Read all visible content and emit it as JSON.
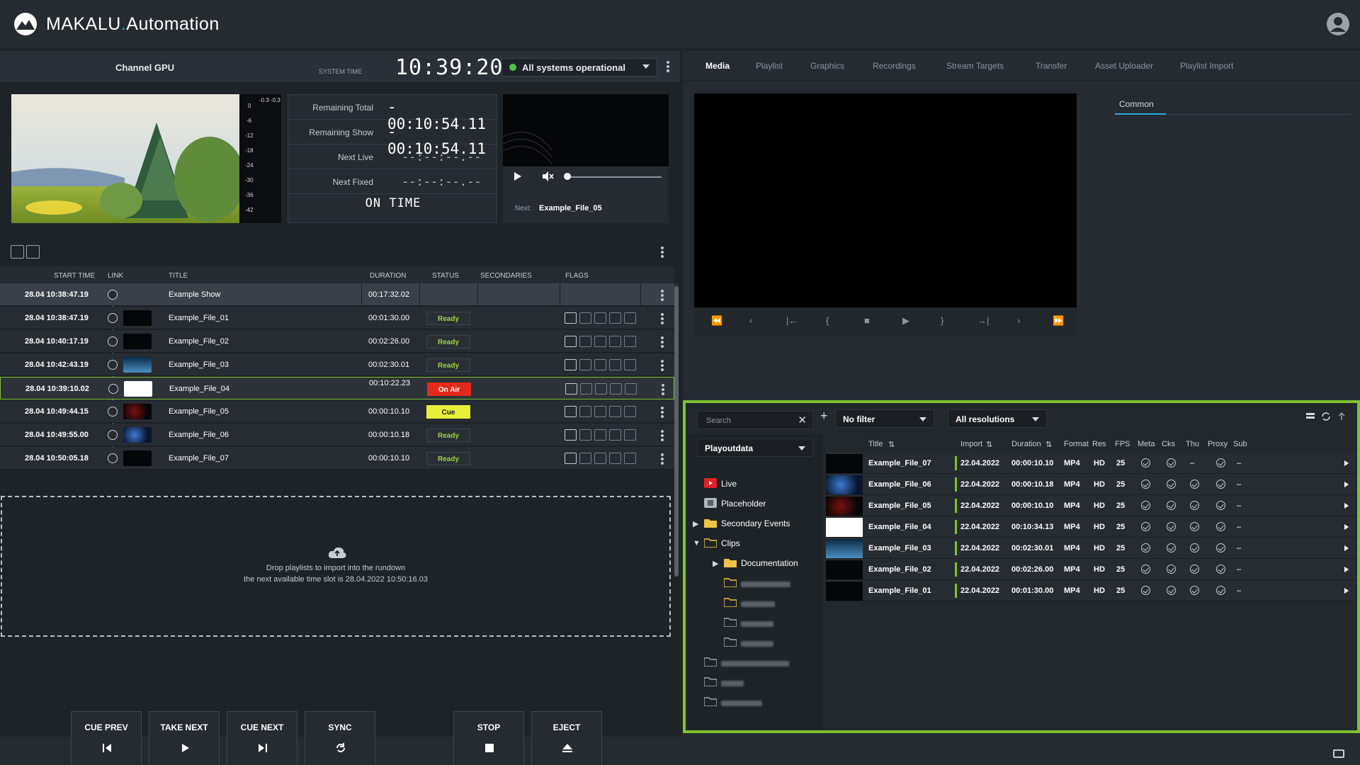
{
  "app": {
    "brand_main": "MAKALU",
    "brand_dot": ".",
    "brand_sub": "Automation"
  },
  "header": {
    "channel": "Channel GPU",
    "system_time_label": "SYSTEM TIME",
    "system_time": "10:39:20",
    "status": "All systems operational",
    "status_color": "#4fc34a"
  },
  "meter": {
    "scale": [
      "0",
      "-6",
      "-12",
      "-18",
      "-24",
      "-30",
      "-36",
      "-42"
    ],
    "peak_l": "-0.3",
    "peak_r": "-0.3"
  },
  "timers": [
    {
      "label": "Remaining Total",
      "value": "- 00:10:54.11"
    },
    {
      "label": "Remaining Show",
      "value": "- 00:10:54.11"
    },
    {
      "label": "Next Live",
      "value": "--:--:--.--"
    },
    {
      "label": "Next Fixed",
      "value": "--:--:--.--"
    }
  ],
  "on_time": "ON TIME",
  "next_player": {
    "next_label": "Next:",
    "next_file": "Example_File_05"
  },
  "rundown": {
    "columns": {
      "start": "START TIME",
      "link": "LINK",
      "title": "TITLE",
      "duration": "DURATION",
      "status": "STATUS",
      "secondaries": "SECONDARIES",
      "flags": "FLAGS"
    },
    "rows": [
      {
        "start": "28.04  10:38:47.19",
        "title": "Example Show",
        "duration": "00:17:32.02",
        "status": "",
        "type": "show"
      },
      {
        "start": "28.04  10:38:47.19",
        "title": "Example_File_01",
        "duration": "00:01:30.00",
        "status": "Ready",
        "type": "ready"
      },
      {
        "start": "28.04  10:40:17.19",
        "title": "Example_File_02",
        "duration": "00:02:26.00",
        "status": "Ready",
        "type": "ready"
      },
      {
        "start": "28.04  10:42:43.19",
        "title": "Example_File_03",
        "duration": "00:02:30.01",
        "status": "Ready",
        "type": "ready"
      },
      {
        "start": "28.04  10:39:10.02",
        "title": "Example_File_04",
        "duration": "00:10:22.23",
        "status": "On Air",
        "type": "onair"
      },
      {
        "start": "28.04  10:49:44.15",
        "title": "Example_File_05",
        "duration": "00:00:10.10",
        "status": "Cue",
        "type": "cue"
      },
      {
        "start": "28.04  10:49:55.00",
        "title": "Example_File_06",
        "duration": "00:00:10.18",
        "status": "Ready",
        "type": "ready"
      },
      {
        "start": "28.04  10:50:05.18",
        "title": "Example_File_07",
        "duration": "00:00:10.10",
        "status": "Ready",
        "type": "ready"
      }
    ],
    "dropzone_line1": "Drop playlists to import into the rundown",
    "dropzone_line2": "the next available time slot is 28.04.2022 10:50:16.03"
  },
  "controls": {
    "cue_prev": "CUE PREV",
    "take_next": "TAKE NEXT",
    "cue_next": "CUE NEXT",
    "sync": "SYNC",
    "stop": "STOP",
    "eject": "EJECT"
  },
  "right": {
    "tabs": [
      "Media",
      "Playlist",
      "Graphics",
      "Recordings",
      "Stream Targets",
      "Transfer",
      "Asset Uploader",
      "Playlist Import"
    ],
    "active_tab": "Media",
    "common": "Common"
  },
  "browser": {
    "search_placeholder": "Search",
    "filter": "No filter",
    "resolution": "All resolutions",
    "source": "Playoutdata",
    "tree": [
      {
        "label": "Live",
        "level": 0,
        "icon": "live-icon"
      },
      {
        "label": "Placeholder",
        "level": 0,
        "icon": "placeholder-icon"
      },
      {
        "label": "Secondary Events",
        "level": 0,
        "icon": "folder-icon"
      },
      {
        "label": "Clips",
        "level": 0,
        "icon": "folder-open-icon"
      },
      {
        "label": "Documentation",
        "level": 1,
        "icon": "folder-icon"
      }
    ],
    "columns": {
      "title": "Title",
      "import": "Import",
      "duration": "Duration",
      "format": "Format",
      "res": "Res",
      "fps": "FPS",
      "meta": "Meta",
      "cks": "Cks",
      "thu": "Thu",
      "proxy": "Proxy",
      "sub": "Sub"
    },
    "files": [
      {
        "title": "Example_File_07",
        "import": "22.04.2022",
        "duration": "00:00:10.10",
        "format": "MP4",
        "res": "HD",
        "fps": "25",
        "thu": "–",
        "sub": "–"
      },
      {
        "title": "Example_File_06",
        "import": "22.04.2022",
        "duration": "00:00:10.18",
        "format": "MP4",
        "res": "HD",
        "fps": "25",
        "thu": "",
        "sub": "–"
      },
      {
        "title": "Example_File_05",
        "import": "22.04.2022",
        "duration": "00:00:10.10",
        "format": "MP4",
        "res": "HD",
        "fps": "25",
        "thu": "",
        "sub": "–"
      },
      {
        "title": "Example_File_04",
        "import": "22.04.2022",
        "duration": "00:10:34.13",
        "format": "MP4",
        "res": "HD",
        "fps": "25",
        "thu": "",
        "sub": "–"
      },
      {
        "title": "Example_File_03",
        "import": "22.04.2022",
        "duration": "00:02:30.01",
        "format": "MP4",
        "res": "HD",
        "fps": "25",
        "thu": "",
        "sub": "–"
      },
      {
        "title": "Example_File_02",
        "import": "22.04.2022",
        "duration": "00:02:26.00",
        "format": "MP4",
        "res": "HD",
        "fps": "25",
        "thu": "",
        "sub": "–"
      },
      {
        "title": "Example_File_01",
        "import": "22.04.2022",
        "duration": "00:01:30.00",
        "format": "MP4",
        "res": "HD",
        "fps": "25",
        "thu": "",
        "sub": "–"
      }
    ]
  },
  "colors": {
    "accent_green": "#7fc22d",
    "on_air": "#e32a1a",
    "cue": "#e6f03a",
    "ready": "#9fd33a"
  }
}
